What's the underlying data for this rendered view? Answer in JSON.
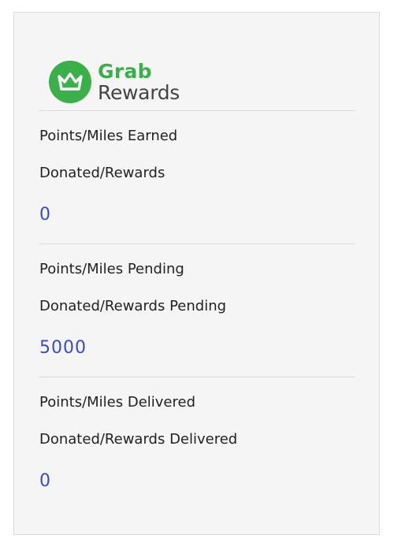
{
  "brand": {
    "name": "Grab",
    "product": "Rewards",
    "primary_color": "#3aaf4a",
    "icon": "crown-icon"
  },
  "sections": [
    {
      "title": "Points/Miles Earned",
      "subtitle": "Donated/Rewards",
      "value": "0"
    },
    {
      "title": "Points/Miles Pending",
      "subtitle": "Donated/Rewards Pending",
      "value": "5000"
    },
    {
      "title": "Points/Miles Delivered",
      "subtitle": "Donated/Rewards Delivered",
      "value": "0"
    }
  ],
  "value_color": "#3b4bcf"
}
